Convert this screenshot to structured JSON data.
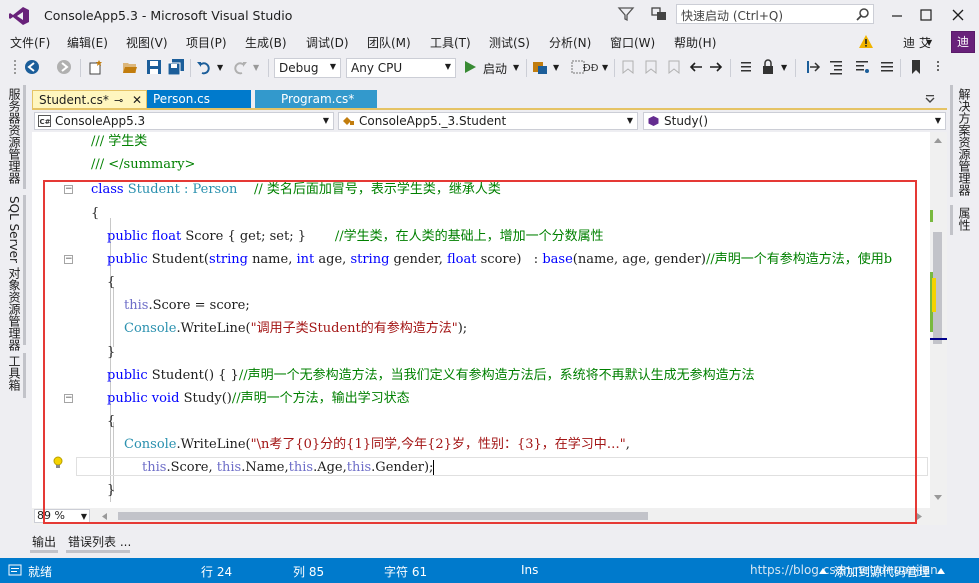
{
  "window": {
    "title": "ConsoleApp5.3 - Microsoft Visual Studio",
    "quick_launch_placeholder": "快速启动 (Ctrl+Q)"
  },
  "menu": {
    "items": [
      "文件(F)",
      "编辑(E)",
      "视图(V)",
      "项目(P)",
      "生成(B)",
      "调试(D)",
      "团队(M)",
      "工具(T)",
      "测试(S)",
      "分析(N)",
      "窗口(W)",
      "帮助(H)"
    ],
    "user_name": "迪 艾",
    "avatar_letter": "迪"
  },
  "toolbar": {
    "configuration": "Debug",
    "platform": "Any CPU",
    "start_label": "启动"
  },
  "left_tool_tabs": [
    "服务器资源管理器",
    "SQL Server 对象资源管理器",
    "工具箱"
  ],
  "right_tool_tabs": [
    "解决方案资源管理器",
    "属性"
  ],
  "doc_tabs": [
    {
      "label": "Student.cs*",
      "active": true
    },
    {
      "label": "Person.cs",
      "active": false
    },
    {
      "label": "Program.cs*",
      "active": false
    }
  ],
  "navbar": {
    "project": "ConsoleApp5.3",
    "type": "ConsoleApp5._3.Student",
    "member": "Study()"
  },
  "code": {
    "l1": "/// 学生类",
    "l2": "/// </summary>",
    "l3_kw": "class",
    "l3_name": "Student",
    "l3_base": ": Person",
    "l3_comment": "// 类名后面加冒号，表示学生类，继承人类",
    "l4": "{",
    "l5_mod": "public",
    "l5_type": "float",
    "l5_name": "Score",
    "l5_acc": "{ get; set; }",
    "l5_comment": "//学生类，在人类的基础上，增加一个分数属性",
    "l6_mod": "public",
    "l6_sig": "Student(",
    "l6_t1": "string",
    "l6_p1": "name,",
    "l6_t2": "int",
    "l6_p2": "age,",
    "l6_t3": "string",
    "l6_p3": "gender,",
    "l6_t4": "float",
    "l6_p4": "score)   :",
    "l6_base": "base",
    "l6_args": "(name, age, gender)",
    "l6_comment": "//声明一个有参构造方法，使用b",
    "l7": "{",
    "l8_this": "this",
    "l8_rest": ".Score = score;",
    "l9_cls": "Console",
    "l9_call": ".WriteLine(",
    "l9_str": "\"调用子类Student的有参构造方法\"",
    "l9_end": ");",
    "l10": "}",
    "l11_mod": "public",
    "l11_sig": "Student() { }",
    "l11_comment": "//声明一个无参构造方法，当我们定义有参构造方法后，系统将不再默认生成无参构造方法",
    "l12_mod": "public",
    "l12_type": "void",
    "l12_name": "Study()",
    "l12_comment": "//声明一个方法，输出学习状态",
    "l13": "{",
    "l14_cls": "Console",
    "l14_call": ".WriteLine(",
    "l14_str": "\"\\n考了{0}分的{1}同学,今年{2}岁，性别：{3}，在学习中…\"",
    "l14_end": ",",
    "l15_this1": "this",
    "l15_p1": ".Score, ",
    "l15_this2": "this",
    "l15_p2": ".Name,",
    "l15_this3": "this",
    "l15_p3": ".Age,",
    "l15_this4": "this",
    "l15_p4": ".Gender);",
    "l16": "}"
  },
  "zoom": "89 %",
  "bottom_tabs": [
    "输出",
    "错误列表 ..."
  ],
  "status": {
    "state": "就绪",
    "row": "行 24",
    "col": "列 85",
    "char": "字符 61",
    "mode": "Ins",
    "source_control": "添加到源代码管理",
    "watermark": "https://blog.csdn.net/dnuanjian"
  },
  "colors": {
    "accent": "#007acc",
    "highlight_box": "#e53935",
    "active_tab": "#fff6bf"
  }
}
